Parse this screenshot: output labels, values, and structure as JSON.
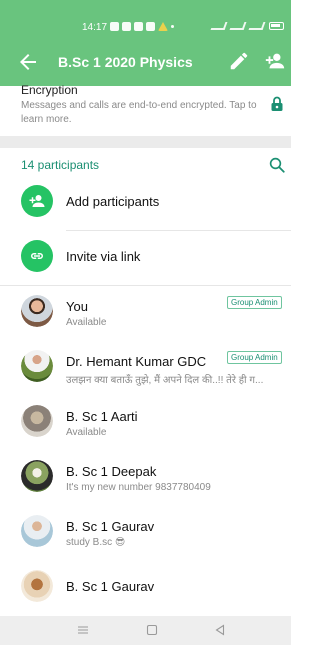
{
  "status_bar": {
    "time": "14:17"
  },
  "app_bar": {
    "title": "B.Sc 1 2020 Physics"
  },
  "encryption": {
    "title": "Encryption",
    "description": "Messages and calls are end-to-end encrypted. Tap to learn more."
  },
  "participants": {
    "header": "14 participants",
    "actions": [
      {
        "label": "Add participants"
      },
      {
        "label": "Invite via link"
      }
    ],
    "list": [
      {
        "name": "You",
        "subtitle": "Available",
        "badge": "Group Admin"
      },
      {
        "name": "Dr. Hemant Kumar GDC",
        "subtitle": "उलझन क्या बताऊँ तुझे, मैं अपने दिल की..!! तेरे ही ग...",
        "badge": "Group Admin"
      },
      {
        "name": "B. Sc 1 Aarti",
        "subtitle": "Available"
      },
      {
        "name": "B. Sc 1 Deepak",
        "subtitle": "It's my new number 9837780409"
      },
      {
        "name": "B. Sc 1 Gaurav",
        "subtitle": "study B.sc 😎"
      },
      {
        "name": "B. Sc 1 Gaurav"
      }
    ]
  },
  "colors": {
    "header": "#69c47e",
    "accent": "#1b8f72",
    "action_circle": "#25c364"
  }
}
